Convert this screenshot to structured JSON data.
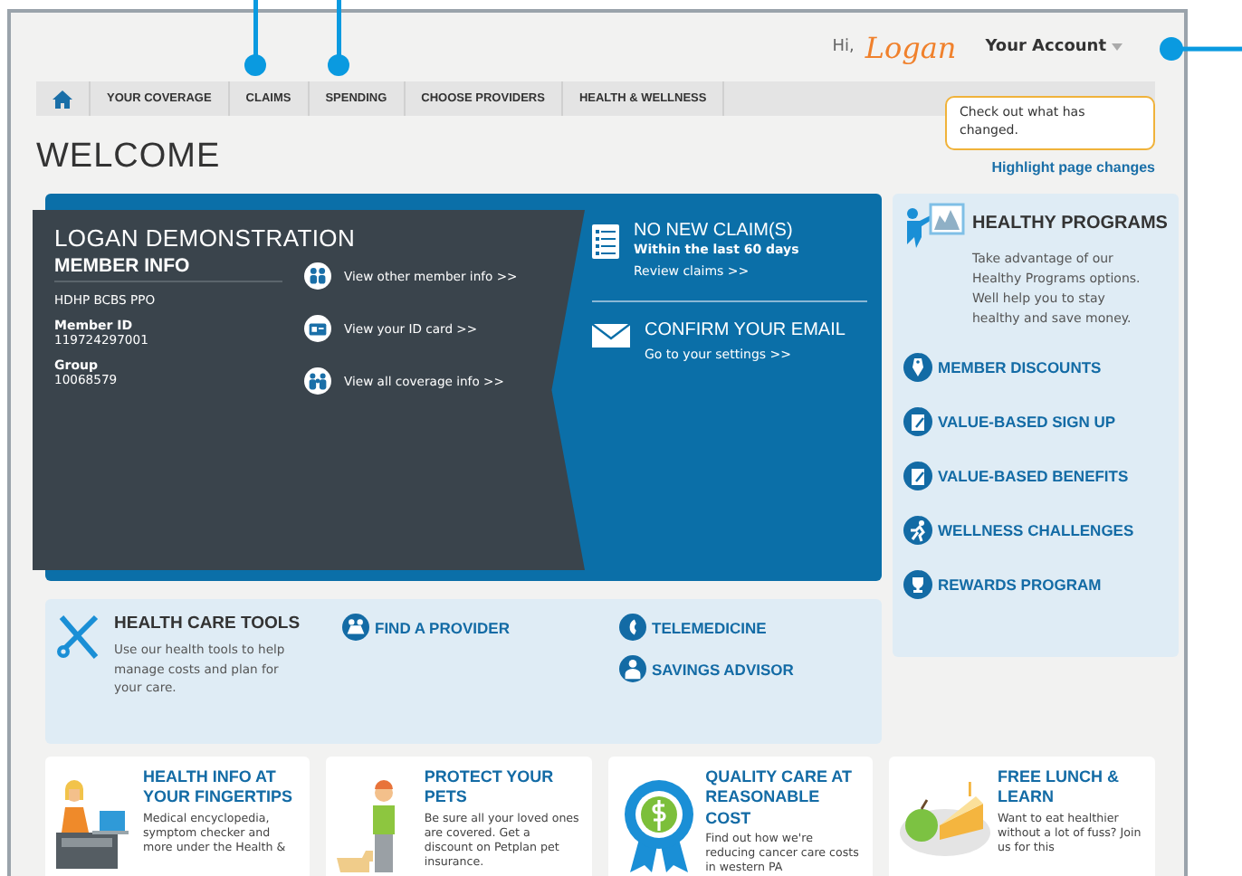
{
  "header": {
    "greeting": "Hi,",
    "user_name": "Logan",
    "account_menu": "Your Account"
  },
  "nav": {
    "items": [
      {
        "label": "YOUR COVERAGE"
      },
      {
        "label": "CLAIMS"
      },
      {
        "label": "SPENDING"
      },
      {
        "label": "CHOOSE PROVIDERS"
      },
      {
        "label": "HEALTH & WELLNESS"
      }
    ]
  },
  "tooltip": "Check out what has changed.",
  "highlight_link": "Highlight page changes",
  "page_title": "WELCOME",
  "member": {
    "name": "LOGAN DEMONSTRATION",
    "section": "MEMBER INFO",
    "plan": "HDHP BCBS PPO",
    "fields": [
      {
        "label": "Member ID",
        "value": "119724297001"
      },
      {
        "label": "Group",
        "value": "10068579"
      }
    ],
    "links": [
      {
        "label": "View other member info >>"
      },
      {
        "label": "View your ID card >>"
      },
      {
        "label": "View all coverage info >>"
      }
    ]
  },
  "alerts": [
    {
      "title": "NO NEW CLAIM(S)",
      "subtitle": "Within the last 60 days",
      "link": "Review claims >>"
    },
    {
      "title": "CONFIRM YOUR EMAIL",
      "link": "Go to your settings >>"
    }
  ],
  "healthy_programs": {
    "title": "HEALTHY PROGRAMS",
    "description": "Take advantage of our Healthy Programs options. Well help you to stay healthy and save money.",
    "links": [
      {
        "label": "MEMBER DISCOUNTS"
      },
      {
        "label": "VALUE-BASED SIGN UP"
      },
      {
        "label": "VALUE-BASED BENEFITS"
      },
      {
        "label": "WELLNESS CHALLENGES"
      },
      {
        "label": "REWARDS PROGRAM"
      }
    ]
  },
  "tools": {
    "title": "HEALTH CARE TOOLS",
    "description": "Use our health tools to help manage costs and plan for your care.",
    "columns": [
      [
        {
          "label": "FIND A PROVIDER"
        }
      ],
      [
        {
          "label": "TELEMEDICINE"
        },
        {
          "label": "SAVINGS ADVISOR"
        }
      ]
    ]
  },
  "promos": [
    {
      "title": "HEALTH INFO AT YOUR FINGERTIPS",
      "description": "Medical encyclopedia, symptom checker and more under the Health &"
    },
    {
      "title": "PROTECT YOUR PETS",
      "description": "Be sure all your loved ones are covered. Get a discount on Petplan pet insurance."
    },
    {
      "title": "QUALITY CARE AT REASONABLE COST",
      "description": "Find out how we're reducing cancer care costs in western PA"
    },
    {
      "title": "FREE LUNCH & LEARN",
      "description": "Want to eat healthier without a lot of fuss? Join us for this"
    }
  ]
}
